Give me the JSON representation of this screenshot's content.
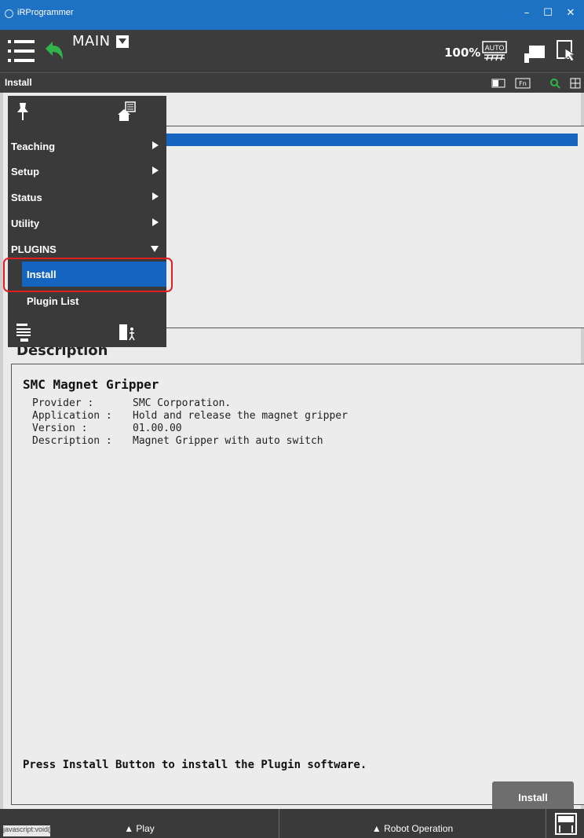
{
  "window": {
    "title": "iRProgrammer",
    "minimize": "–",
    "maximize": "☐",
    "close": "✕"
  },
  "toolbar": {
    "program_name": "MAIN",
    "zoom": "100%",
    "auto_label": "AUTO"
  },
  "screen": {
    "title": "Install"
  },
  "menu": {
    "items": [
      {
        "label": "Teaching",
        "arrow": "right"
      },
      {
        "label": "Setup",
        "arrow": "right"
      },
      {
        "label": "Status",
        "arrow": "right"
      },
      {
        "label": "Utility",
        "arrow": "right"
      },
      {
        "label": "PLUGINS",
        "arrow": "down"
      }
    ],
    "subitems": [
      {
        "label": "Install",
        "active": true
      },
      {
        "label": "Plugin List",
        "active": false
      }
    ]
  },
  "description": {
    "heading": "Description",
    "plugin_name": "SMC Magnet Gripper",
    "rows": [
      {
        "key": "Provider :",
        "value": "SMC Corporation."
      },
      {
        "key": "Application :",
        "value": "Hold and release the magnet gripper"
      },
      {
        "key": "Version :",
        "value": "01.00.00"
      },
      {
        "key": "Description :",
        "value": "Magnet Gripper with auto switch"
      }
    ],
    "press_text": "Press Install Button to install the Plugin software.",
    "install_button": "Install"
  },
  "bottom": {
    "play": "▲ Play",
    "robot_operation": "▲ Robot Operation",
    "status_link": "javascript:void(0);"
  },
  "colors": {
    "title_bar": "#1e72c4",
    "toolbar": "#3c3c3c",
    "selection": "#1565c0",
    "highlight": "#e02020"
  }
}
